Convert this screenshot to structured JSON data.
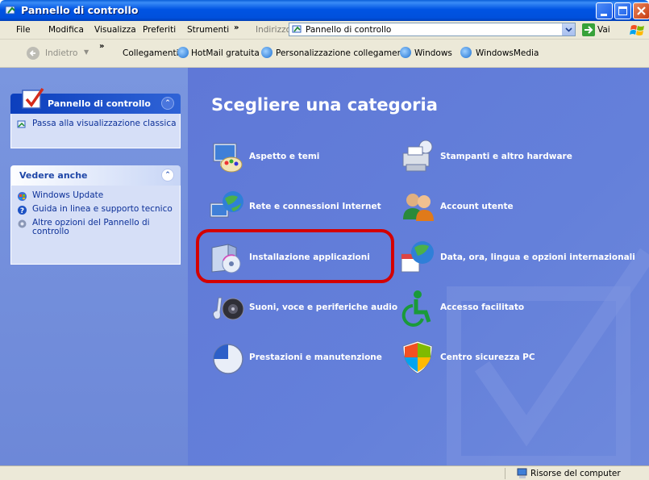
{
  "window": {
    "title": "Pannello di controllo"
  },
  "menu": {
    "items": [
      "File",
      "Modifica",
      "Visualizza",
      "Preferiti",
      "Strumenti"
    ],
    "chevron": "»",
    "address_label": "Indirizzo",
    "address_value": "Pannello di controllo",
    "go_label": "Vai"
  },
  "toolbar": {
    "back_label": "Indietro",
    "chevron": "»",
    "links_label": "Collegamenti",
    "links": [
      "HotMail gratuita",
      "Personalizzazione collegamenti",
      "Windows",
      "WindowsMedia"
    ]
  },
  "sidebar": {
    "panel_title": "Pannello di controllo",
    "panel_link": "Passa alla visualizzazione classica",
    "see_also_title": "Vedere anche",
    "see_also": [
      "Windows Update",
      "Guida in linea e supporto tecnico",
      "Altre opzioni del Pannello di controllo"
    ]
  },
  "main": {
    "heading": "Scegliere una categoria",
    "categories": [
      {
        "label": "Aspetto e temi",
        "icon": "appearance-themes-icon"
      },
      {
        "label": "Stampanti e altro hardware",
        "icon": "printer-hardware-icon"
      },
      {
        "label": "Rete e connessioni Internet",
        "icon": "network-internet-icon"
      },
      {
        "label": "Account utente",
        "icon": "user-accounts-icon"
      },
      {
        "label": "Installazione applicazioni",
        "icon": "add-remove-programs-icon"
      },
      {
        "label": "Data, ora, lingua e opzioni internazionali",
        "icon": "date-time-language-icon"
      },
      {
        "label": "Suoni, voce e periferiche audio",
        "icon": "sounds-audio-icon"
      },
      {
        "label": "Accesso facilitato",
        "icon": "accessibility-icon"
      },
      {
        "label": "Prestazioni e manutenzione",
        "icon": "performance-maintenance-icon"
      },
      {
        "label": "Centro sicurezza PC",
        "icon": "security-center-icon"
      }
    ]
  },
  "status": {
    "location": "Risorse del computer"
  },
  "colors": {
    "highlight": "#d40000",
    "pane_blue": "#6b86dc"
  }
}
